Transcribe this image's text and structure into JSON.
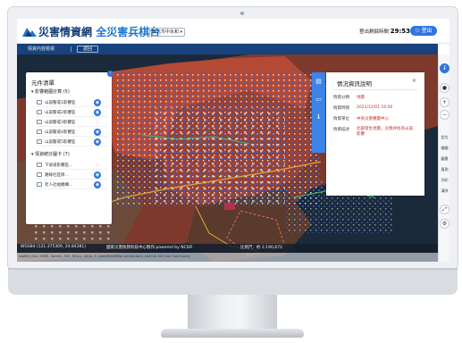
{
  "header": {
    "brand_primary": "災害情資網",
    "brand_secondary": "全災害兵棋台",
    "selector_value": "新北市中永和",
    "timer_label": "登出剩餘時間",
    "timer_value": "29:53",
    "logout_label": "登出"
  },
  "subbar": {
    "title": "情資內容檢視",
    "back_label": "返回"
  },
  "layers_panel": {
    "title": "元件清單",
    "group_1": "影響範圍計算 (5)",
    "group_1_items": [
      "山崩警戒1影響區",
      "山崩警戒2影響區",
      "山崩警戒3影響區",
      "山崩警戒4影響區",
      "山崩警戒5影響區"
    ],
    "group_2": "情資統計圖卡 (7)",
    "group_2_items": [
      "下坡道影響區...",
      "路線社區情...",
      "老人社福機構..."
    ]
  },
  "info_panel": {
    "title": "情況資訊說明",
    "close": "×",
    "rows": [
      {
        "key": "情資分類",
        "value": "地震"
      },
      {
        "key": "情資時間",
        "value": "2021/12/01 16:00"
      },
      {
        "key": "情資單位",
        "value": "中央災害應變中心"
      },
      {
        "key": "情資描述",
        "value": "北部發生地震，災情評估為山崩影響"
      }
    ]
  },
  "rightbar": {
    "labels": [
      "i",
      "定位",
      "繪圖",
      "圖層",
      "量測",
      "列印",
      "清除"
    ]
  },
  "statusbar": {
    "coords": "WGS84 (121.375309, 24.84381)",
    "org": "國家災害防救科技中心製作 powered by NCDR",
    "scale": "比例尺：約 1:190,672"
  },
  "attribution": "Leaflet | Esri, HERE, Garmin, FAO, NOAA, USGS, © OpenStreetMap contributors, and the GIS User Community",
  "colors": {
    "brand_dark": "#123d7a",
    "brand_blue": "#1b78d0",
    "accent": "#2f74e0",
    "danger_fill": "#b44a35"
  }
}
